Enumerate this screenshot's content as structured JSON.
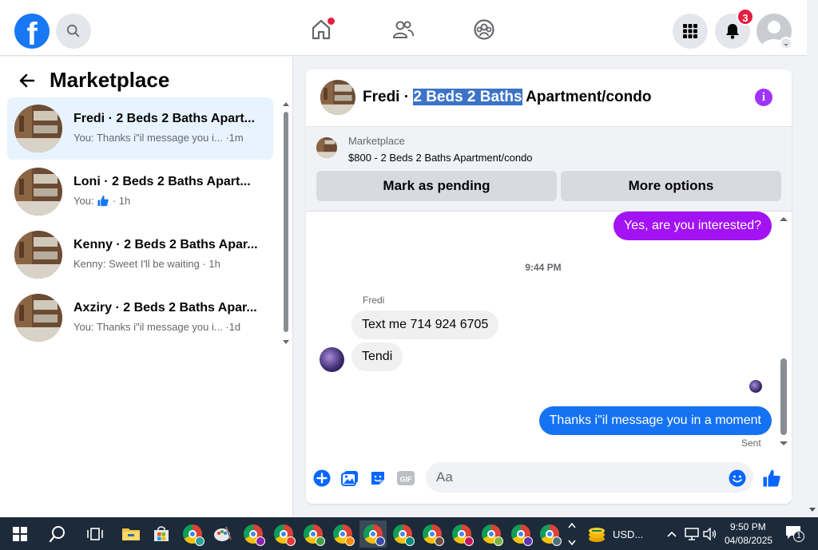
{
  "header": {
    "logo": "f",
    "notifications_count": "3",
    "icons": [
      "search-icon",
      "home-icon",
      "friends-icon",
      "groups-icon",
      "menu-grid-icon",
      "bell-icon",
      "profile-icon",
      "chevron-down-icon"
    ]
  },
  "sidebar": {
    "title": "Marketplace",
    "conversations": [
      {
        "name": "Fredi · 2 Beds 2 Baths Apart...",
        "preview": "You: Thanks i\"il message you i... ·1m",
        "active": true
      },
      {
        "name": "Loni · 2 Beds 2 Baths Apart...",
        "preview_prefix": "You:",
        "preview_suffix": "· 1h",
        "active": false
      },
      {
        "name": "Kenny · 2 Beds 2 Baths Apar...",
        "preview": "Kenny: Sweet I'll be waiting · 1h",
        "active": false
      },
      {
        "name": "Axziry · 2 Beds 2 Baths Apar...",
        "preview": "You: Thanks i\"il message you i... ·1d",
        "active": false
      }
    ]
  },
  "chat": {
    "title_prefix": "Fredi · ",
    "title_selected": "2 Beds 2 Baths",
    "title_suffix": " Apartment/condo",
    "listing": {
      "label": "Marketplace",
      "price_title": "$800 - 2 Beds 2 Baths Apartment/condo",
      "mark_pending": "Mark as pending",
      "more_options": "More options"
    },
    "messages": {
      "out1": "Yes, are you interested?",
      "time": "9:44 PM",
      "sender": "Fredi",
      "in1": "Text me 714 924 6705",
      "in2": "Tendi",
      "out2": "Thanks i\"il message you in a moment",
      "status": "Sent"
    },
    "composer": {
      "placeholder": "Aa"
    }
  },
  "taskbar": {
    "tray_app": "USD...",
    "time": "9:50 PM",
    "date": "04/08/2025",
    "notification_count": "1"
  },
  "colors": {
    "brand": "#1877f2",
    "purple_bubble": "#a213f4",
    "blue_bubble": "#1572f3",
    "badge": "#e41e3f"
  }
}
